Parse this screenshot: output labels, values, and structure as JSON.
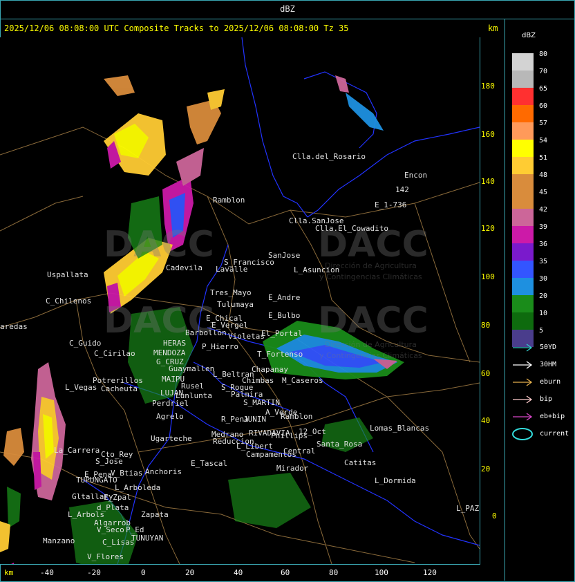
{
  "header": {
    "unit_label": "dBZ",
    "title": "2025/12/06 08:08:00 UTC Composite Tracks to 2025/12/06 08:08:00 Tz 35",
    "km_top": "km",
    "km_bottom": "km"
  },
  "y_axis": {
    "ticks": [
      "180",
      "160",
      "140",
      "120",
      "100",
      "80",
      "60",
      "40",
      "20",
      "0"
    ]
  },
  "x_axis": {
    "ticks": [
      "-40",
      "-20",
      "0",
      "20",
      "40",
      "60",
      "80",
      "100",
      "120"
    ]
  },
  "legend": {
    "title": "dBZ",
    "scale": [
      {
        "label": "80",
        "color": "#d3d3d3"
      },
      {
        "label": "70",
        "color": "#b8b8b8"
      },
      {
        "label": "65",
        "color": "#ff3030"
      },
      {
        "label": "60",
        "color": "#ff6a00"
      },
      {
        "label": "57",
        "color": "#ff9a5a"
      },
      {
        "label": "54",
        "color": "#ffff00"
      },
      {
        "label": "51",
        "color": "#ffcc33"
      },
      {
        "label": "48",
        "color": "#d98c3c"
      },
      {
        "label": "45",
        "color": "#d98c3c"
      },
      {
        "label": "42",
        "color": "#cc6699"
      },
      {
        "label": "39",
        "color": "#cc1aa8"
      },
      {
        "label": "36",
        "color": "#7a1acc"
      },
      {
        "label": "35",
        "color": "#3355ff"
      },
      {
        "label": "30",
        "color": "#1e90e0"
      },
      {
        "label": "20",
        "color": "#1a8c1a"
      },
      {
        "label": "10",
        "color": "#0e6b0e"
      },
      {
        "label": "5",
        "color": "#4a3d8c"
      }
    ],
    "tracks": [
      {
        "label": "50YD",
        "color": "#33cccc"
      },
      {
        "label": "30HM",
        "color": "#ffffff"
      },
      {
        "label": "eburn",
        "color": "#e6b04d"
      },
      {
        "label": "bip",
        "color": "#ffcccc"
      },
      {
        "label": "eb+bip",
        "color": "#d946c9"
      },
      {
        "label": "current",
        "color": "#33dddd"
      }
    ]
  },
  "watermarks": {
    "brand": "DACC",
    "line1": "Dirección de Agricultura",
    "line2": "y Contingencias Climáticas"
  },
  "places": [
    "Clla.del_Rosario",
    "Encon",
    "142",
    "E_1-736",
    "Ramblon",
    "Clla.SanJose",
    "Clla.El_Cowadito",
    "SanJose",
    "L_Asuncion",
    "S_Francisco",
    "Lavalle",
    "Cadevila",
    "Uspallata",
    "C_Chilenos",
    "Tres_Mayo",
    "Tulumaya",
    "E_Andre",
    "E_Chical",
    "E_Vergel",
    "E_Bulbo",
    "Barbollon",
    "Violetas",
    "El_Portal",
    "P_Hierro",
    "T_Fortenso",
    "C_Guido",
    "C_Cirilao",
    "HERAS",
    "MENDOZA",
    "G_CRUZ",
    "Guaymallen",
    "Chapanay",
    "L_Beltran",
    "Chimbas",
    "M_Caseros",
    "Potrerillos",
    "Cacheuta",
    "L_Vegas",
    "MAIPU",
    "Rusel",
    "LUJAN",
    "Lunlunta",
    "S_Roque",
    "Palmira",
    "S_MARTIN",
    "Perdriel",
    "Agrelo",
    "A_Verde",
    "Ramblon",
    "R_Pena",
    "JUNIN",
    "Lomas_Blancas",
    "Medrano",
    "RIVADAVIA",
    "Phillips",
    "12_Oct",
    "Reduccion",
    "L_Libert",
    "Ugarteche",
    "La_Carrera",
    "Cto_Rey",
    "S_Jose",
    "Santa_Rosa",
    "Campamentos",
    "Central",
    "Catitas",
    "E_Pena",
    "V_Btias",
    "Anchoris",
    "E_Tascal",
    "TUPUNGATO",
    "L_Arboleda",
    "Mirador",
    "L_Dormida",
    "Gltallary",
    "E_Zpal",
    "d_Plata",
    "L_Arbols",
    "Zapata",
    "Algarrob",
    "V_Seco",
    "P_Ed",
    "TUNUYAN",
    "Manzano",
    "C_Lisas",
    "V_Flores",
    "L_PAZ",
    "aredas"
  ]
}
